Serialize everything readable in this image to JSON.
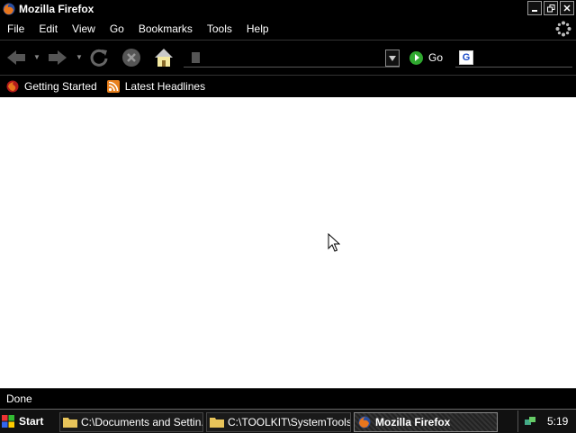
{
  "window": {
    "title": "Mozilla Firefox"
  },
  "menu": {
    "items": [
      "File",
      "Edit",
      "View",
      "Go",
      "Bookmarks",
      "Tools",
      "Help"
    ]
  },
  "navbar": {
    "url_value": "",
    "go_label": "Go"
  },
  "bookmarks": {
    "items": [
      "Getting Started",
      "Latest Headlines"
    ]
  },
  "status": {
    "text": "Done"
  },
  "taskbar": {
    "start_label": "Start",
    "tasks": [
      "C:\\Documents and Settin...",
      "C:\\TOOLKIT\\SystemTools",
      "Mozilla Firefox"
    ],
    "clock": "5:19"
  },
  "icons": {
    "app": "firefox-icon",
    "back": "back-arrow-icon",
    "forward": "forward-arrow-icon",
    "reload": "reload-icon",
    "stop": "stop-icon",
    "home": "home-icon",
    "go": "go-arrow-icon",
    "search_engine": "google-icon",
    "throbber": "throbber-icon",
    "bookmark1": "firefox-bookmark-icon",
    "bookmark2": "rss-feed-icon",
    "folder": "folder-icon",
    "tray": "network-icon"
  },
  "colors": {
    "content_bg": "#ffffff",
    "chrome_bg": "#000000",
    "go_green": "#2fa82f"
  }
}
